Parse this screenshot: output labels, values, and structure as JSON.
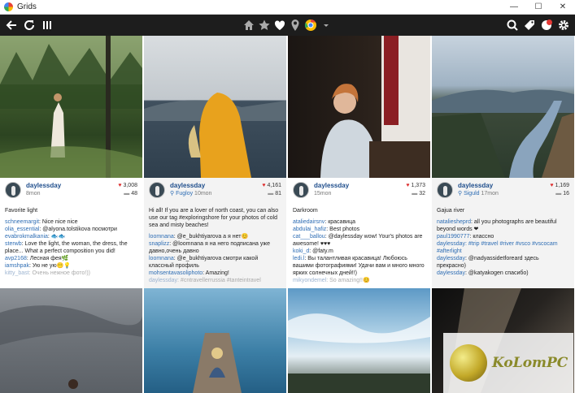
{
  "app": {
    "title": "Grids",
    "minimize": "—",
    "maximize": "☐",
    "close": "✕"
  },
  "toolbar": {
    "left_icons": [
      "back-arrow-icon",
      "refresh-icon",
      "columns-icon"
    ],
    "center_icons": [
      "home-icon",
      "star-icon",
      "heart-icon",
      "location-pin-icon",
      "chrome-icon",
      "dropdown-caret-icon"
    ],
    "right_icons": [
      "search-icon",
      "tag-icon",
      "notifications-icon",
      "gear-icon"
    ]
  },
  "posts": [
    {
      "user": "daylessday",
      "time": "8mon",
      "location": "",
      "likes": "3,008",
      "comments": "48",
      "caption": "Favorite light",
      "comment_list": [
        {
          "u": "schneemargit",
          "text": ": Nice nice nice"
        },
        {
          "u": "olia_essential",
          "text": ": @alyona.tolstikova посмотри"
        },
        {
          "u": "evabrokmalkania",
          "text": ": 🐟🐟"
        },
        {
          "u": "sterwb",
          "text": ": Love the light, the woman, the dress, the place... What a perfect composition you did!"
        },
        {
          "u": "avp2168",
          "text": ": Лесная фея🌿"
        },
        {
          "u": "iamshpak",
          "text": ": Ую не ую😶💡"
        },
        {
          "u": "kitty_bast",
          "text": ": Очень нежное фото!))"
        }
      ]
    },
    {
      "user": "daylessday",
      "time": "10mon",
      "location": "Fugloy",
      "likes": "4,161",
      "comments": "81",
      "caption": "Hi all! If you are a lover of north coast, you can also use our tag #exploringshore for your photos of cold sea and misty beaches!",
      "comment_list": [
        {
          "u": "loomnana",
          "text": ": @e_bukhtiyarova а я нет😊"
        },
        {
          "u": "snaplizz",
          "text": ": @loomnana я на него подписана уже давно,очень давно"
        },
        {
          "u": "loomnana",
          "text": ": @e_bukhtiyarova смотри какой классный профиль"
        },
        {
          "u": "mohsentavasoliphoto",
          "text": ": Amazing!"
        },
        {
          "u": "daylessday",
          "text": ": #cntravellerrussia #tanteintravel"
        }
      ]
    },
    {
      "user": "daylessday",
      "time": "15mon",
      "location": "",
      "likes": "1,373",
      "comments": "32",
      "caption": "Darkroom",
      "comment_list": [
        {
          "u": "ataliedairsnv",
          "text": ": красавица"
        },
        {
          "u": "abdulai_hafiz",
          "text": ": Best photos"
        },
        {
          "u": "cat___ballou",
          "text": ": @daylessday wow! Your's photos are awesome! ♥♥♥"
        },
        {
          "u": "koki_d",
          "text": ": @faty.m"
        },
        {
          "u": "ledi.l",
          "text": ": Вы талантливая красавица! Любоюсь вашими фотографиями! Удачи вам и много много ярких солнечных дней!!)"
        },
        {
          "u": "mikyondemel",
          "text": ": So amazing!!😊"
        }
      ]
    },
    {
      "user": "daylessday",
      "time": "17mon",
      "location": "Siguld",
      "likes": "1,169",
      "comments": "16",
      "caption": "Gajua river",
      "comment_list": [
        {
          "u": "nataliesheprd",
          "text": ": all you photographs are beautiful beyond words ❤"
        },
        {
          "u": "paul1990777",
          "text": ": классно"
        },
        {
          "u": "daylessday",
          "text": ": #trip #travel #river #vsco #vscocam #afterlight"
        },
        {
          "u": "daylessday",
          "text": ": @nadyassidetforeard здесь прекрасно)"
        },
        {
          "u": "daylessday",
          "text": ": @katyakogen спасибо)"
        }
      ]
    }
  ],
  "watermark": {
    "text": "KoLomPC"
  }
}
